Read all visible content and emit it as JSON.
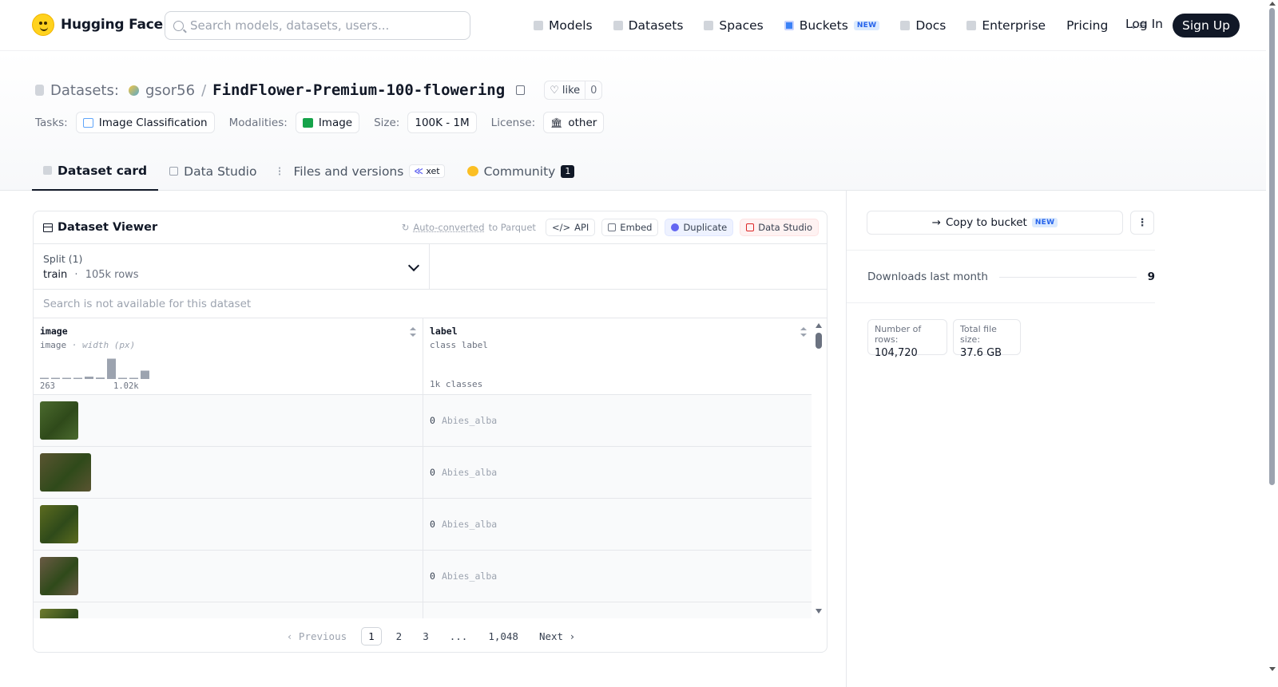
{
  "nav": {
    "brand": "Hugging Face",
    "search_placeholder": "Search models, datasets, users...",
    "links": [
      {
        "label": "Models",
        "icon": "cube-icon"
      },
      {
        "label": "Datasets",
        "icon": "database-icon"
      },
      {
        "label": "Spaces",
        "icon": "grid-icon"
      },
      {
        "label": "Buckets",
        "icon": "bucket-icon",
        "badge": "NEW"
      },
      {
        "label": "Docs",
        "icon": "book-icon"
      },
      {
        "label": "Enterprise",
        "icon": "enterprise-icon"
      },
      {
        "label": "Pricing"
      }
    ],
    "login": "Log In",
    "signup": "Sign Up"
  },
  "header": {
    "section": "Datasets:",
    "owner": "gsor56",
    "slash": "/",
    "repo": "FindFlower-Premium-100-flowering",
    "like_label": "like",
    "like_count": "0",
    "tasks_label": "Tasks:",
    "task": "Image Classification",
    "modalities_label": "Modalities:",
    "modality": "Image",
    "size_label": "Size:",
    "size": "100K - 1M",
    "license_label": "License:",
    "license": "other"
  },
  "tabs": {
    "dataset_card": "Dataset card",
    "data_studio": "Data Studio",
    "files": "Files and versions",
    "xet": "xet",
    "community": "Community",
    "community_count": "1"
  },
  "viewer": {
    "title": "Dataset Viewer",
    "auto_converted": "Auto-converted",
    "to_parquet": " to Parquet",
    "api": "API",
    "embed": "Embed",
    "duplicate": "Duplicate",
    "data_studio": "Data Studio",
    "split_label": "Split (1)",
    "split_name": "train",
    "split_sep": "·",
    "split_rows": "105k rows",
    "search_disabled": "Search is not available for this dataset",
    "columns": [
      {
        "name": "image",
        "type": "image",
        "subtype": "· width (px)",
        "axis_min": "263",
        "axis_max": "1.02k"
      },
      {
        "name": "label",
        "type": "class label",
        "classes": "1k classes"
      }
    ],
    "histogram": [
      0.02,
      0.02,
      0.02,
      0.02,
      0.1,
      0.06,
      0.85,
      0.03,
      0.03,
      0.35
    ],
    "rows": [
      {
        "label_id": "0",
        "label_name": "Abies_alba",
        "thumb_color": "#4b6a2e",
        "thumb_w": 48
      },
      {
        "label_id": "0",
        "label_name": "Abies_alba",
        "thumb_color": "#5a5431",
        "thumb_w": 64
      },
      {
        "label_id": "0",
        "label_name": "Abies_alba",
        "thumb_color": "#5c6b1f",
        "thumb_w": 48
      },
      {
        "label_id": "0",
        "label_name": "Abies_alba",
        "thumb_color": "#6a5a44",
        "thumb_w": 48
      },
      {
        "label_id": "",
        "label_name": "",
        "thumb_color": "#6f7c2e",
        "thumb_w": 48
      }
    ],
    "pager": {
      "previous": "Previous",
      "pages": [
        "1",
        "2",
        "3",
        "...",
        "1,048"
      ],
      "next": "Next"
    }
  },
  "sidebar": {
    "copy_to_bucket": "Copy to bucket",
    "new_badge": "NEW",
    "downloads_label": "Downloads last month",
    "downloads_value": "9",
    "rows_label": "Number of rows:",
    "rows_value": "104,720",
    "size_label": "Total file size:",
    "size_value": "37.6 GB"
  },
  "colors": {
    "accent": "#111827",
    "link_blue": "#2563eb",
    "histogram_bar": "#9ca3af"
  }
}
